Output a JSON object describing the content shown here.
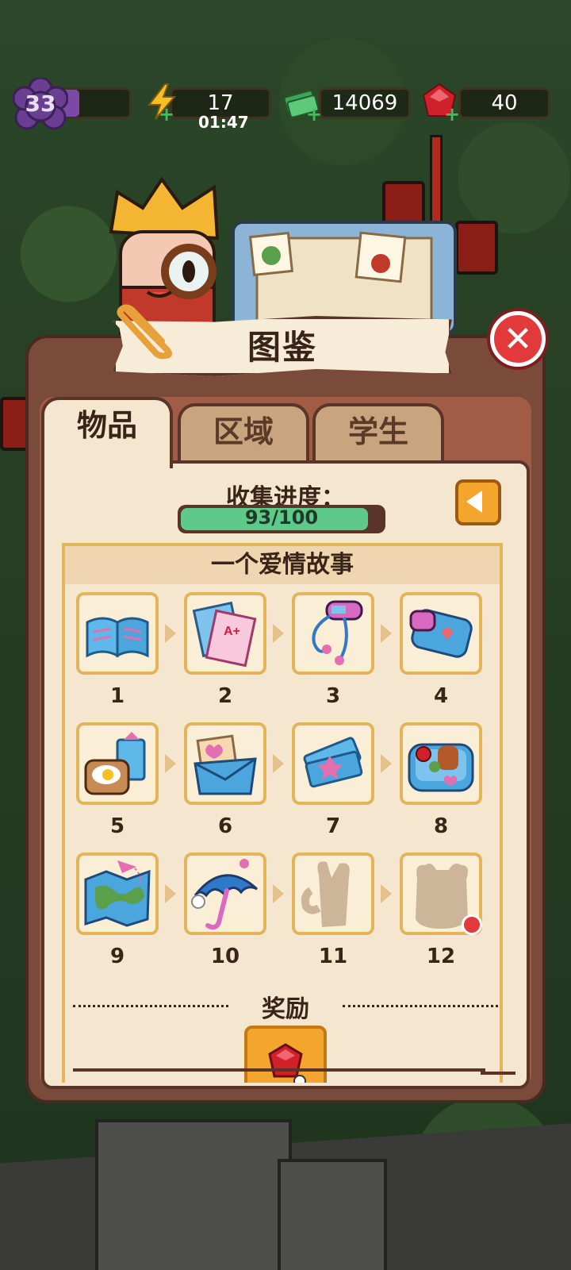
{
  "hud": {
    "level": "33",
    "energy": "17",
    "energy_timer": "01:47",
    "cash": "14069",
    "gems": "40"
  },
  "title": "图鉴",
  "tabs": [
    {
      "label": "物品",
      "active": true
    },
    {
      "label": "区域",
      "active": false
    },
    {
      "label": "学生",
      "active": false
    }
  ],
  "progress": {
    "label": "收集进度：",
    "current": 93,
    "total": 100,
    "text": "93/100"
  },
  "collection": {
    "title": "一个爱情故事",
    "items": [
      {
        "number": "1",
        "icon": "open-book-icon",
        "unlocked": true
      },
      {
        "number": "2",
        "icon": "test-papers-icon",
        "unlocked": true
      },
      {
        "number": "3",
        "icon": "mp3-player-icon",
        "unlocked": true
      },
      {
        "number": "4",
        "icon": "pencil-case-icon",
        "unlocked": true
      },
      {
        "number": "5",
        "icon": "breakfast-toast-icon",
        "unlocked": true
      },
      {
        "number": "6",
        "icon": "love-letter-icon",
        "unlocked": true
      },
      {
        "number": "7",
        "icon": "tickets-icon",
        "unlocked": true
      },
      {
        "number": "8",
        "icon": "bento-box-icon",
        "unlocked": true
      },
      {
        "number": "9",
        "icon": "map-icon",
        "unlocked": true
      },
      {
        "number": "10",
        "icon": "umbrella-icon",
        "unlocked": true
      },
      {
        "number": "11",
        "icon": "locked-mug-silhouette-icon",
        "unlocked": false
      },
      {
        "number": "12",
        "icon": "locked-bear-silhouette-icon",
        "unlocked": false
      }
    ],
    "reward_label": "奖励",
    "reward_icon": "ruby-gem-icon"
  },
  "colors": {
    "panel": "#7a4a3a",
    "paper": "#f5e6cf",
    "accent": "#e3b45a",
    "progress": "#5ec988",
    "close": "#e23a3a",
    "button": "#f3a52e"
  }
}
